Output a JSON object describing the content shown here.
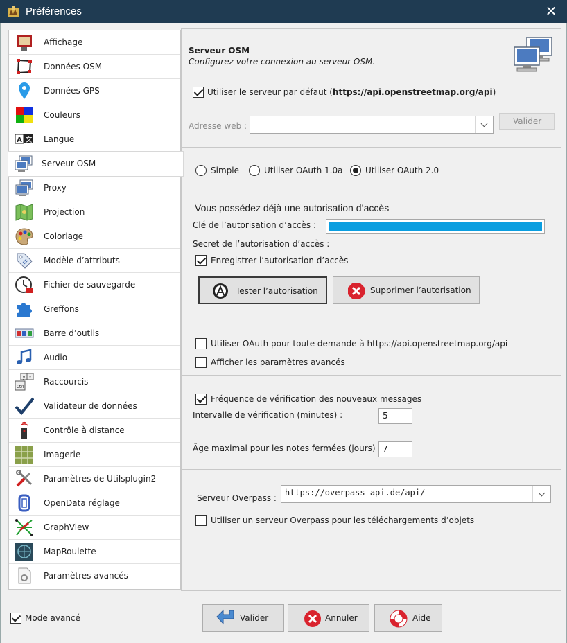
{
  "window": {
    "title": "Préférences",
    "close": "✕"
  },
  "sidebar": {
    "items": [
      {
        "label": "Affichage",
        "icon": "display-icon"
      },
      {
        "label": "Données OSM",
        "icon": "osm-data-icon"
      },
      {
        "label": "Données GPS",
        "icon": "gps-pin-icon"
      },
      {
        "label": "Couleurs",
        "icon": "colors-icon"
      },
      {
        "label": "Langue",
        "icon": "language-icon"
      },
      {
        "label": "Serveur OSM",
        "icon": "server-icon",
        "selected": true
      },
      {
        "label": "Proxy",
        "icon": "proxy-icon"
      },
      {
        "label": "Projection",
        "icon": "map-projection-icon"
      },
      {
        "label": "Coloriage",
        "icon": "palette-icon"
      },
      {
        "label": "Modèle d’attributs",
        "icon": "tag-icon"
      },
      {
        "label": "Fichier de sauvegarde",
        "icon": "backup-clock-icon"
      },
      {
        "label": "Greffons",
        "icon": "puzzle-icon"
      },
      {
        "label": "Barre d’outils",
        "icon": "toolbar-icon"
      },
      {
        "label": "Audio",
        "icon": "music-note-icon"
      },
      {
        "label": "Raccourcis",
        "icon": "keyboard-shortcut-icon"
      },
      {
        "label": "Validateur de données",
        "icon": "checkmark-icon"
      },
      {
        "label": "Contrôle à distance",
        "icon": "remote-control-icon"
      },
      {
        "label": "Imagerie",
        "icon": "imagery-grid-icon"
      },
      {
        "label": "Paramètres de Utilsplugin2",
        "icon": "tools-icon"
      },
      {
        "label": "OpenData réglage",
        "icon": "opendata-icon"
      },
      {
        "label": "GraphView",
        "icon": "graphview-icon"
      },
      {
        "label": "MapRoulette",
        "icon": "maproulette-icon"
      },
      {
        "label": "Paramètres avancés",
        "icon": "advanced-settings-icon"
      }
    ]
  },
  "panel": {
    "title": "Serveur OSM",
    "subtitle": "Configurez votre connexion au serveur OSM.",
    "use_default_prefix": "Utiliser le serveur par défaut (",
    "use_default_url": "https://api.openstreetmap.org/api",
    "use_default_suffix": ")",
    "use_default_checked": true,
    "web_address_label": "Adresse web :",
    "web_address_value": "",
    "validate_url_button": "Valider",
    "auth": {
      "options": [
        "Simple",
        "Utiliser OAuth 1.0a",
        "Utiliser OAuth 2.0"
      ],
      "selected": 2
    },
    "have_token_heading": "Vous possédez déjà une autorisation d’accès",
    "token_key_label": "Clé de l’autorisation d’accès :",
    "token_secret_label": "Secret de l’autorisation d’accès :",
    "save_token_label": "Enregistrer l’autorisation d’accès",
    "save_token_checked": true,
    "test_auth_button": "Tester l’autorisation",
    "delete_auth_button": "Supprimer l’autorisation",
    "use_oauth_all_label": "Utiliser OAuth pour toute demande à https://api.openstreetmap.org/api",
    "use_oauth_all_checked": false,
    "show_advanced_label": "Afficher les paramètres avancés",
    "show_advanced_checked": false,
    "msg_check_label": "Fréquence de vérification des nouveaux messages",
    "msg_check_checked": true,
    "interval_label": "Intervalle de vérification (minutes) :",
    "interval_value": "5",
    "max_age_label": "Âge maximal pour les notes fermées (jours) :",
    "max_age_value": "7",
    "overpass_label": "Serveur Overpass :",
    "overpass_value": "https://overpass-api.de/api/",
    "overpass_use_label": "Utiliser un serveur Overpass pour les téléchargements d’objets",
    "overpass_use_checked": false
  },
  "footer": {
    "expert_mode_label": "Mode avancé",
    "expert_mode_checked": true,
    "ok_button": "Valider",
    "cancel_button": "Annuler",
    "help_button": "Aide"
  },
  "colors": {
    "titlebar": "#1f3b52",
    "token_fill": "#0a9ee0",
    "delete_red": "#d9232e"
  }
}
